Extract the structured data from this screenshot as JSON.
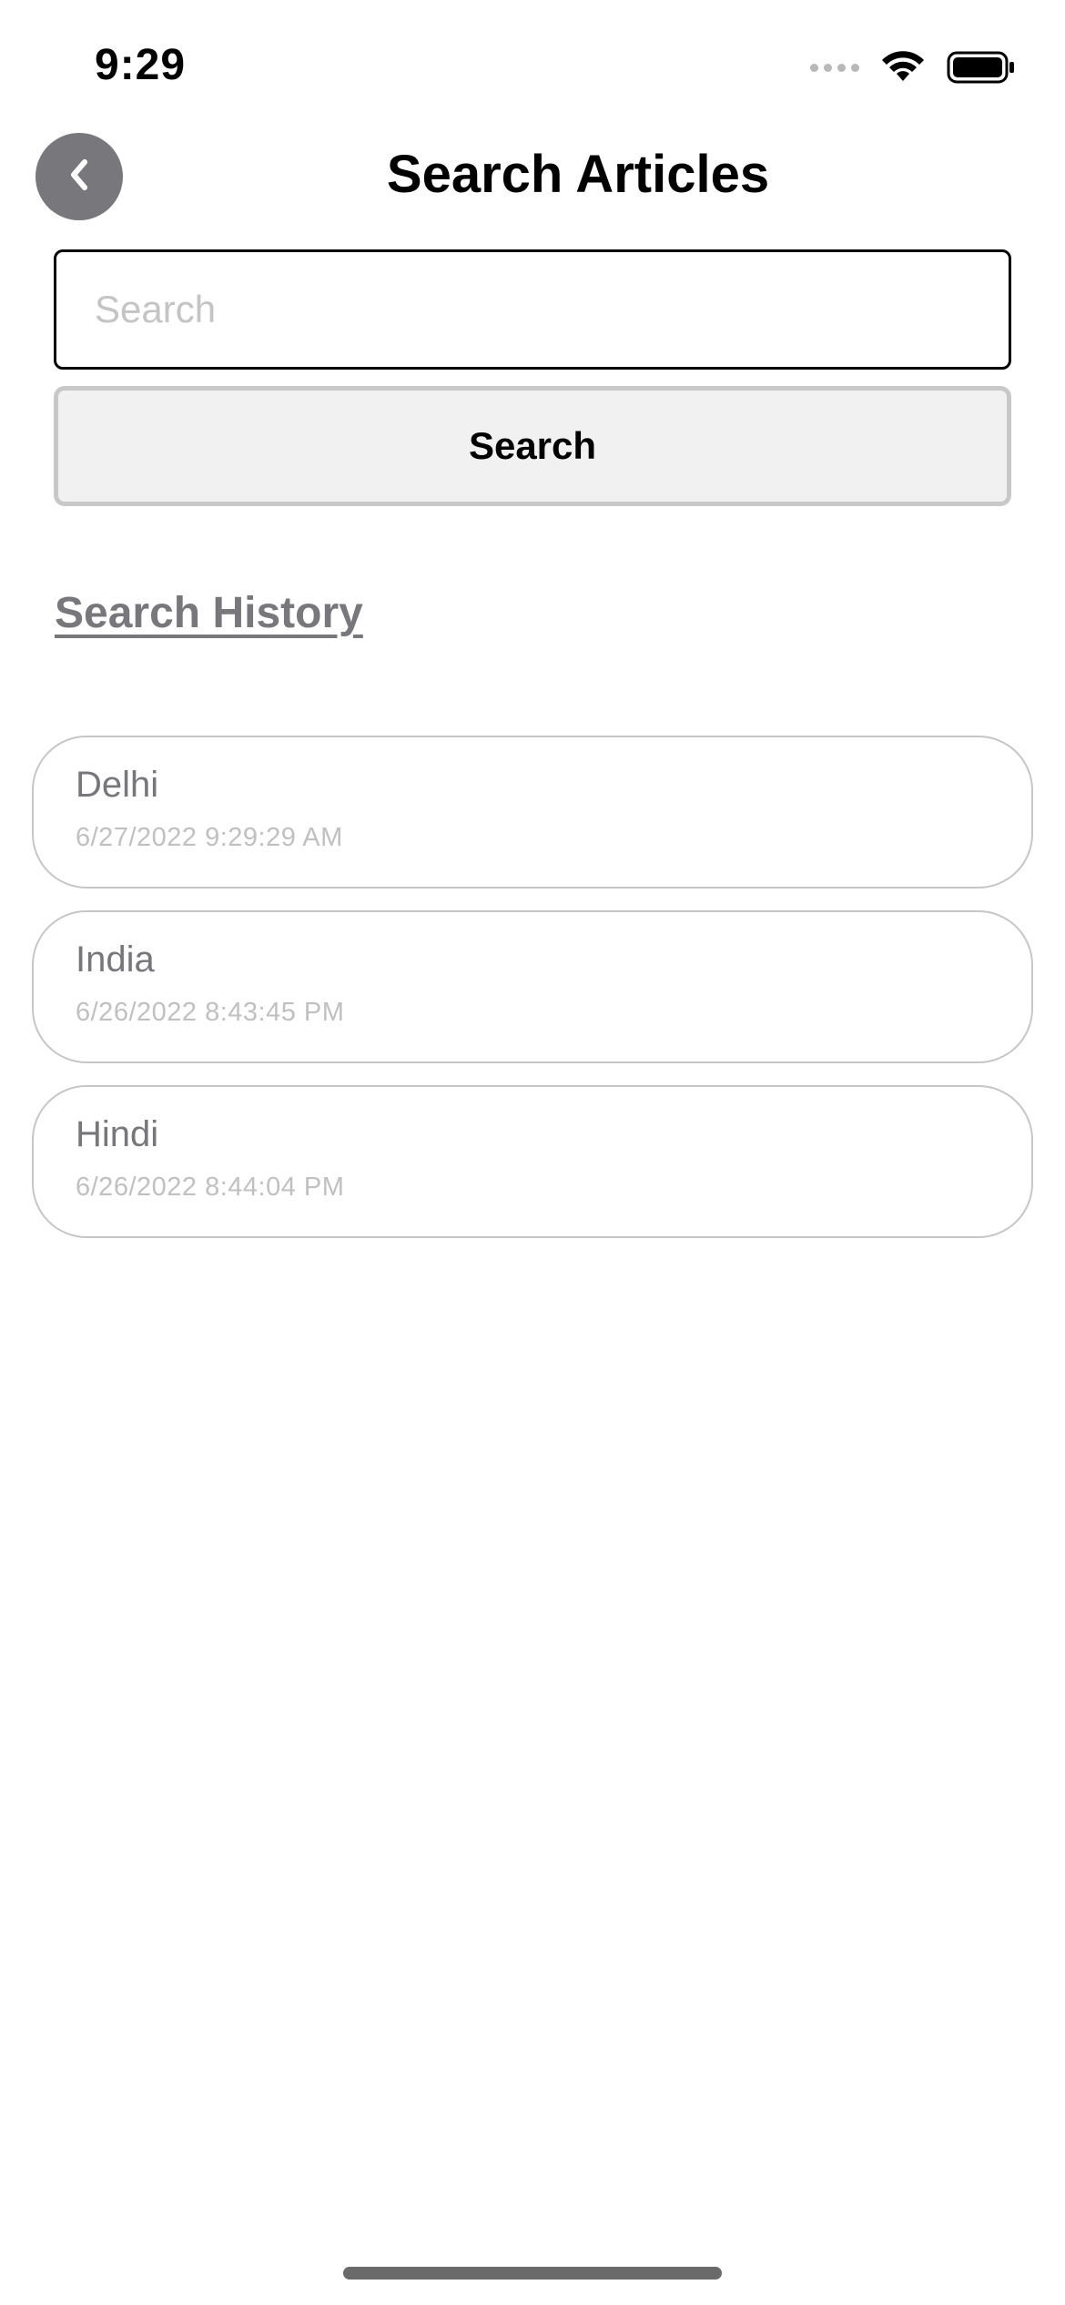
{
  "status_bar": {
    "time": "9:29"
  },
  "header": {
    "title": "Search Articles",
    "back_icon": "chevron-left-icon"
  },
  "search": {
    "placeholder": "Search",
    "value": "",
    "button_label": "Search"
  },
  "history": {
    "heading": "Search History",
    "items": [
      {
        "term": "Delhi",
        "timestamp": "6/27/2022 9:29:29 AM"
      },
      {
        "term": "India",
        "timestamp": "6/26/2022 8:43:45 PM"
      },
      {
        "term": "Hindi",
        "timestamp": "6/26/2022 8:44:04 PM"
      }
    ]
  },
  "colors": {
    "back_button_bg": "#78787c",
    "button_bg": "#f1f1f1",
    "history_heading": "#78787c",
    "history_term": "#77777b",
    "history_timestamp": "#c0c0c2"
  }
}
